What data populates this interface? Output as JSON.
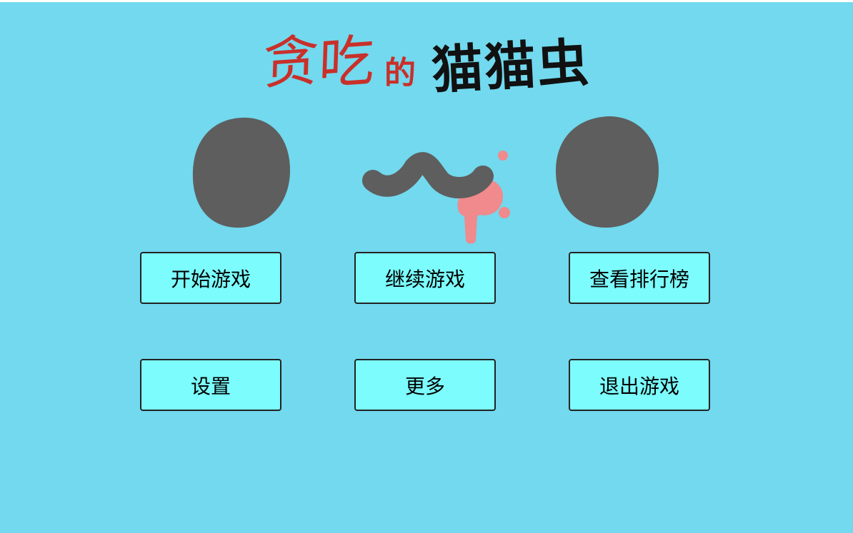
{
  "title": {
    "word1": "贪",
    "word2": "吃",
    "particle": "的",
    "word3": "猫猫虫"
  },
  "colors": {
    "background": "#72d9ee",
    "button_fill": "#7cfcfd",
    "title_red": "#c9302a",
    "face_gray": "#5e5e5e",
    "drool_pink": "#f08a8c"
  },
  "menu": {
    "start": "开始游戏",
    "continue": "继续游戏",
    "leaderboard": "查看排行榜",
    "settings": "设置",
    "more": "更多",
    "quit": "退出游戏"
  }
}
